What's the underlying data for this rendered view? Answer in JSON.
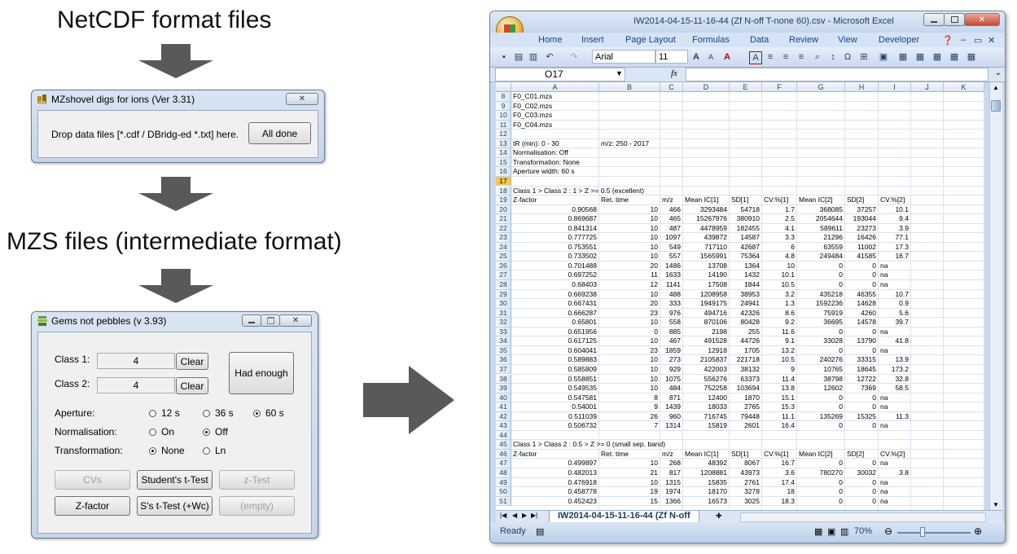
{
  "labels": {
    "netcdf": "NetCDF  format  files",
    "mzs": "MZS files (intermediate format)"
  },
  "mzshovel": {
    "title": "MZshovel digs for ions (Ver 3.31)",
    "drop_text": "Drop data files [*.cdf / DBridg-ed *.txt] here.",
    "done_button": "All done",
    "close_glyph": "✕"
  },
  "gems": {
    "title": "Gems not pebbles (v 3.93)",
    "class1_label": "Class 1:",
    "class1_value": "4",
    "class2_label": "Class 2:",
    "class2_value": "4",
    "clear1": "Clear",
    "clear2": "Clear",
    "had_enough": "Had enough",
    "aperture_label": "Aperture:",
    "aperture_options": [
      "12 s",
      "36 s",
      "60 s"
    ],
    "normalisation_label": "Normalisation:",
    "normalisation_options": [
      "On",
      "Off"
    ],
    "transformation_label": "Transformation:",
    "transformation_options": [
      "None",
      "Ln"
    ],
    "buttons": {
      "cvs": "CVs",
      "students_t": "Student's t-Test",
      "z_test": "z-Test",
      "z_factor": "Z-factor",
      "ss_t": "S's t-Test (+Wc)",
      "empty": "(empty)"
    }
  },
  "excel": {
    "title": "IW2014-04-15-11-16-44 (Zf N-off T-none 60).csv - Microsoft Excel",
    "tabs": [
      "Home",
      "Insert",
      "Page Layout",
      "Formulas",
      "Data",
      "Review",
      "View",
      "Developer"
    ],
    "font_name": "Arial",
    "font_size": "11",
    "name_box": "O17",
    "fx": "fx",
    "columns": [
      "A",
      "B",
      "C",
      "D",
      "E",
      "F",
      "G",
      "H",
      "I",
      "J",
      "K"
    ],
    "sheet_tab": "IW2014-04-15-11-16-44 (Zf N-off",
    "status": "Ready",
    "zoom": "70%",
    "rows": [
      {
        "n": "8",
        "c": [
          "F0_C01.mzs"
        ]
      },
      {
        "n": "9",
        "c": [
          "F0_C02.mzs"
        ]
      },
      {
        "n": "10",
        "c": [
          "F0_C03.mzs"
        ]
      },
      {
        "n": "11",
        "c": [
          "F0_C04.mzs"
        ]
      },
      {
        "n": "12",
        "c": []
      },
      {
        "n": "13",
        "c": [
          "tR (min): 0 - 30",
          "m/z: 250 - 2017"
        ]
      },
      {
        "n": "14",
        "c": [
          "Normalisation: Off"
        ]
      },
      {
        "n": "15",
        "c": [
          "Transformation: None"
        ]
      },
      {
        "n": "16",
        "c": [
          "Aperture width: 60 s"
        ]
      },
      {
        "n": "17",
        "c": []
      },
      {
        "n": "18",
        "c": [
          "Class 1 > Class 2 : 1 > Z >= 0.5 (excellent)"
        ]
      },
      {
        "n": "19",
        "c": [
          "Z-factor",
          "Ret. time",
          "m/z",
          "Mean IC[1]",
          "SD[1]",
          "CV.%[1]",
          "Mean IC[2]",
          "SD[2]",
          "CV.%[2]"
        ]
      },
      {
        "n": "20",
        "c": [
          "0.90568",
          "10",
          "466",
          "3293484",
          "54718",
          "1.7",
          "368085",
          "37257",
          "10.1"
        ]
      },
      {
        "n": "21",
        "c": [
          "0.869687",
          "10",
          "465",
          "15267976",
          "380910",
          "2.5",
          "2054644",
          "193044",
          "9.4"
        ]
      },
      {
        "n": "22",
        "c": [
          "0.841314",
          "10",
          "487",
          "4478959",
          "182455",
          "4.1",
          "589611",
          "23273",
          "3.9"
        ]
      },
      {
        "n": "23",
        "c": [
          "0.777725",
          "10",
          "1097",
          "439872",
          "14587",
          "3.3",
          "21296",
          "16426",
          "77.1"
        ]
      },
      {
        "n": "24",
        "c": [
          "0.753551",
          "10",
          "549",
          "717110",
          "42687",
          "6",
          "63559",
          "11002",
          "17.3"
        ]
      },
      {
        "n": "25",
        "c": [
          "0.733502",
          "10",
          "557",
          "1565991",
          "75364",
          "4.8",
          "249484",
          "41585",
          "16.7"
        ]
      },
      {
        "n": "26",
        "c": [
          "0.701488",
          "20",
          "1486",
          "13708",
          "1364",
          "10",
          "0",
          "0",
          "na"
        ]
      },
      {
        "n": "27",
        "c": [
          "0.697252",
          "11",
          "1633",
          "14190",
          "1432",
          "10.1",
          "0",
          "0",
          "na"
        ]
      },
      {
        "n": "28",
        "c": [
          "0.68403",
          "12",
          "1141",
          "17508",
          "1844",
          "10.5",
          "0",
          "0",
          "na"
        ]
      },
      {
        "n": "29",
        "c": [
          "0.669238",
          "10",
          "488",
          "1208958",
          "38953",
          "3.2",
          "435218",
          "46355",
          "10.7"
        ]
      },
      {
        "n": "30",
        "c": [
          "0.667431",
          "20",
          "333",
          "1949175",
          "24941",
          "1.3",
          "1592236",
          "14628",
          "0.9"
        ]
      },
      {
        "n": "31",
        "c": [
          "0.666287",
          "23",
          "976",
          "494716",
          "42326",
          "8.6",
          "75919",
          "4260",
          "5.6"
        ]
      },
      {
        "n": "32",
        "c": [
          "0.65801",
          "10",
          "558",
          "870106",
          "80428",
          "9.2",
          "36695",
          "14578",
          "39.7"
        ]
      },
      {
        "n": "33",
        "c": [
          "0.651956",
          "0",
          "885",
          "2198",
          "255",
          "11.6",
          "0",
          "0",
          "na"
        ]
      },
      {
        "n": "34",
        "c": [
          "0.617125",
          "10",
          "467",
          "491528",
          "44726",
          "9.1",
          "33028",
          "13790",
          "41.8"
        ]
      },
      {
        "n": "35",
        "c": [
          "0.604041",
          "23",
          "1859",
          "12918",
          "1705",
          "13.2",
          "0",
          "0",
          "na"
        ]
      },
      {
        "n": "36",
        "c": [
          "0.589883",
          "10",
          "273",
          "2105837",
          "221718",
          "10.5",
          "240276",
          "33315",
          "13.9"
        ]
      },
      {
        "n": "37",
        "c": [
          "0.585809",
          "10",
          "929",
          "422003",
          "38132",
          "9",
          "10765",
          "18645",
          "173.2"
        ]
      },
      {
        "n": "38",
        "c": [
          "0.558851",
          "10",
          "1075",
          "556276",
          "63373",
          "11.4",
          "38798",
          "12722",
          "32.8"
        ]
      },
      {
        "n": "39",
        "c": [
          "0.549535",
          "10",
          "484",
          "752258",
          "103694",
          "13.8",
          "12602",
          "7369",
          "58.5"
        ]
      },
      {
        "n": "40",
        "c": [
          "0.547581",
          "8",
          "871",
          "12400",
          "1870",
          "15.1",
          "0",
          "0",
          "na"
        ]
      },
      {
        "n": "41",
        "c": [
          "0.54001",
          "9",
          "1439",
          "18033",
          "2765",
          "15.3",
          "0",
          "0",
          "na"
        ]
      },
      {
        "n": "42",
        "c": [
          "0.511039",
          "26",
          "960",
          "716745",
          "79448",
          "11.1",
          "135269",
          "15325",
          "11.3"
        ]
      },
      {
        "n": "43",
        "c": [
          "0.506732",
          "7",
          "1314",
          "15819",
          "2601",
          "16.4",
          "0",
          "0",
          "na"
        ]
      },
      {
        "n": "44",
        "c": []
      },
      {
        "n": "45",
        "c": [
          "Class 1 > Class 2 : 0.5 > Z >= 0 (small sep. band)"
        ]
      },
      {
        "n": "46",
        "c": [
          "Z-factor",
          "Ret. time",
          "m/z",
          "Mean IC[1]",
          "SD[1]",
          "CV.%[1]",
          "Mean IC[2]",
          "SD[2]",
          "CV.%[2]"
        ]
      },
      {
        "n": "47",
        "c": [
          "0.499897",
          "10",
          "268",
          "48392",
          "8067",
          "16.7",
          "0",
          "0",
          "na"
        ]
      },
      {
        "n": "48",
        "c": [
          "0.482013",
          "21",
          "817",
          "1208881",
          "43973",
          "3.6",
          "780270",
          "30032",
          "3.8"
        ]
      },
      {
        "n": "49",
        "c": [
          "0.476918",
          "10",
          "1315",
          "15835",
          "2761",
          "17.4",
          "0",
          "0",
          "na"
        ]
      },
      {
        "n": "50",
        "c": [
          "0.458778",
          "19",
          "1974",
          "18170",
          "3278",
          "18",
          "0",
          "0",
          "na"
        ]
      },
      {
        "n": "51",
        "c": [
          "0.452423",
          "15",
          "1366",
          "16573",
          "3025",
          "18.3",
          "0",
          "0",
          "na"
        ]
      }
    ]
  }
}
